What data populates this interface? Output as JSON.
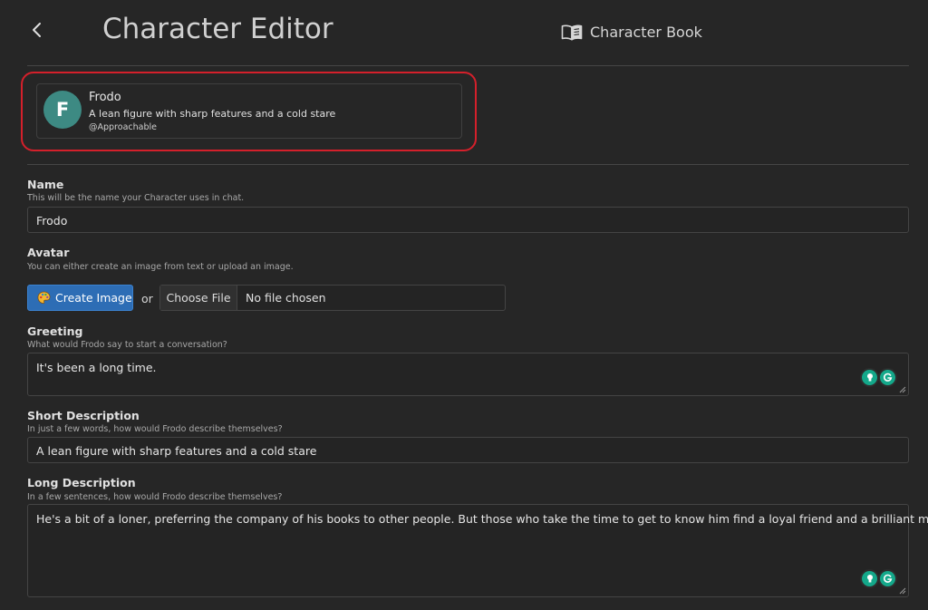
{
  "header": {
    "title": "Character Editor",
    "book_label": "Character Book"
  },
  "preview": {
    "initial": "F",
    "name": "Frodo",
    "description": "A lean figure with sharp features and a cold stare",
    "handle": "@Approachable",
    "avatar_color": "#3d8a83",
    "highlight_color": "#d4202b"
  },
  "form": {
    "name": {
      "label": "Name",
      "hint": "This will be the name your Character uses in chat.",
      "value": "Frodo"
    },
    "avatar": {
      "label": "Avatar",
      "hint": "You can either create an image from text or upload an image.",
      "create_label": "Create Image",
      "or_text": "or",
      "choose_label": "Choose File",
      "file_status": "No file chosen"
    },
    "greeting": {
      "label": "Greeting",
      "hint": "What would Frodo say to start a conversation?",
      "value": "It's been a long time."
    },
    "short_description": {
      "label": "Short Description",
      "hint": "In just a few words, how would Frodo describe themselves?",
      "value": "A lean figure with sharp features and a cold stare"
    },
    "long_description": {
      "label": "Long Description",
      "hint": "In a few sentences, how would Frodo describe themselves?",
      "value": "He's a bit of a loner, preferring the company of his books to other people. But those who take the time to get to know him find a loyal friend and a brilliant mind."
    }
  },
  "colors": {
    "background": "#262626",
    "primary_button": "#2d6db5",
    "grammar_tool": "#14a88a"
  }
}
